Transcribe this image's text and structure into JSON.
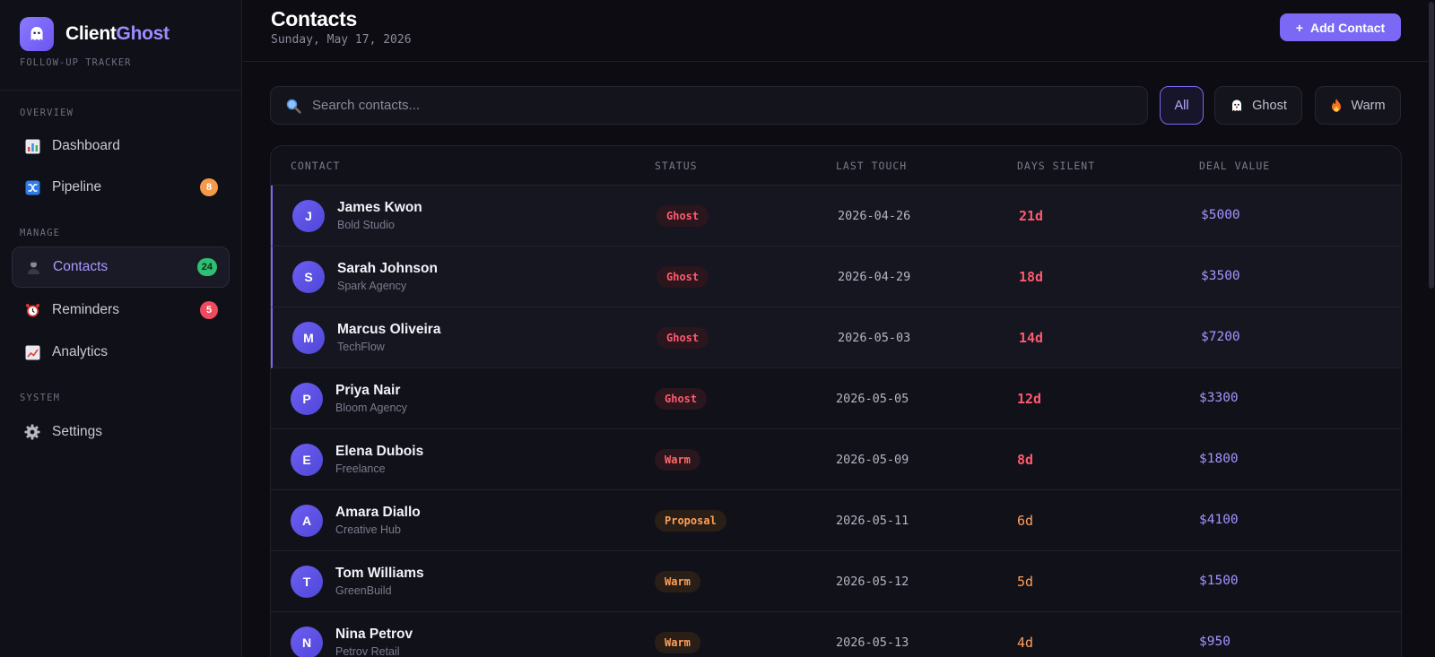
{
  "brand": {
    "name_part1": "Client",
    "name_part2": "Ghost",
    "subtitle": "FOLLOW-UP TRACKER",
    "logo_icon": "ghost-icon"
  },
  "sidebar": {
    "sections": [
      {
        "label": "OVERVIEW"
      },
      {
        "label": "MANAGE"
      },
      {
        "label": "SYSTEM"
      }
    ],
    "items": [
      {
        "label": "Dashboard",
        "icon": "bar-chart-icon"
      },
      {
        "label": "Pipeline",
        "icon": "shuffle-icon",
        "badge": "8",
        "badge_color": "#f59a4a"
      },
      {
        "label": "Contacts",
        "icon": "person-icon",
        "badge": "24",
        "badge_color": "#2fbf72",
        "active": true
      },
      {
        "label": "Reminders",
        "icon": "alarm-clock-icon",
        "badge": "5",
        "badge_color": "#ef4a5e"
      },
      {
        "label": "Analytics",
        "icon": "trend-chart-icon"
      },
      {
        "label": "Settings",
        "icon": "gear-icon"
      }
    ]
  },
  "header": {
    "title": "Contacts",
    "date": "Sunday, May 17, 2026",
    "add_button": "Add Contact",
    "add_button_icon": "+"
  },
  "search": {
    "placeholder": "Search contacts...",
    "value": ""
  },
  "filters": [
    {
      "label": "All",
      "active": true
    },
    {
      "label": "Ghost",
      "icon": "ghost-icon"
    },
    {
      "label": "Warm",
      "icon": "fire-icon"
    }
  ],
  "table": {
    "columns": [
      "CONTACT",
      "STATUS",
      "LAST TOUCH",
      "DAYS SILENT",
      "DEAL VALUE"
    ],
    "rows": [
      {
        "initial": "J",
        "name": "James Kwon",
        "company": "Bold Studio",
        "status": "Ghost",
        "last_touch": "2026-04-26",
        "days": "21d",
        "deal": "$5000"
      },
      {
        "initial": "S",
        "name": "Sarah Johnson",
        "company": "Spark Agency",
        "status": "Ghost",
        "last_touch": "2026-04-29",
        "days": "18d",
        "deal": "$3500"
      },
      {
        "initial": "M",
        "name": "Marcus Oliveira",
        "company": "TechFlow",
        "status": "Ghost",
        "last_touch": "2026-05-03",
        "days": "14d",
        "deal": "$7200"
      },
      {
        "initial": "P",
        "name": "Priya Nair",
        "company": "Bloom Agency",
        "status": "Ghost",
        "last_touch": "2026-05-05",
        "days": "12d",
        "deal": "$3300"
      },
      {
        "initial": "E",
        "name": "Elena Dubois",
        "company": "Freelance",
        "status": "Warm",
        "last_touch": "2026-05-09",
        "days": "8d",
        "deal": "$1800"
      },
      {
        "initial": "A",
        "name": "Amara Diallo",
        "company": "Creative Hub",
        "status": "Proposal",
        "last_touch": "2026-05-11",
        "days": "6d",
        "deal": "$4100"
      },
      {
        "initial": "T",
        "name": "Tom Williams",
        "company": "GreenBuild",
        "status": "Warm",
        "last_touch": "2026-05-12",
        "days": "5d",
        "deal": "$1500"
      },
      {
        "initial": "N",
        "name": "Nina Petrov",
        "company": "Petrov Retail",
        "status": "Warm",
        "last_touch": "2026-05-13",
        "days": "4d",
        "deal": "$950"
      }
    ]
  },
  "colors": {
    "accent": "#7b68f5",
    "ghost_status": "#ff5a6e",
    "warm_status": "#ff9f5a",
    "deal_value": "#a394ff"
  }
}
